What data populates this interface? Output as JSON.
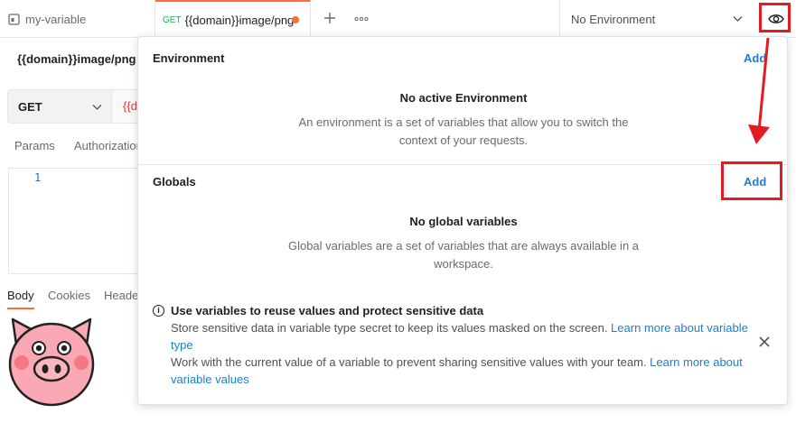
{
  "tabs": {
    "first": {
      "label": "my-variable",
      "icon": "request-icon"
    },
    "active": {
      "method": "GET",
      "label": "{{domain}}image/png",
      "unsaved": true
    },
    "add_icon": "plus-icon",
    "more_icon": "more-icon"
  },
  "environment_selector": {
    "value": "No Environment",
    "icon": "chevron-down-icon"
  },
  "quick_look_icon": "eye-icon",
  "request": {
    "title": "{{domain}}image/png",
    "method": "GET",
    "url_fragment": "{{d",
    "tabs": [
      "Params",
      "Authorization"
    ],
    "editor_line": "1"
  },
  "response": {
    "tabs": [
      "Body",
      "Cookies",
      "Heade"
    ]
  },
  "panel": {
    "environment": {
      "heading": "Environment",
      "add_label": "Add",
      "empty_title": "No active Environment",
      "empty_desc": "An environment is a set of variables that allow you to switch the context of your requests."
    },
    "globals": {
      "heading": "Globals",
      "add_label": "Add",
      "empty_title": "No global variables",
      "empty_desc": "Global variables are a set of variables that are always available in a workspace."
    },
    "info": {
      "icon": "info-icon",
      "title": "Use variables to reuse values and protect sensitive data",
      "line1_text": "Store sensitive data in variable type secret to keep its values masked on the screen. ",
      "line1_link_a": "Learn more about variable",
      "line1_link_b": "type",
      "line2_text": "Work with the current value of a variable to prevent sharing sensitive values with your team. ",
      "line2_link_a": "Learn more about",
      "line2_link_b": "variable values",
      "close_icon": "close-icon"
    }
  },
  "colors": {
    "accent_orange": "#ff6c37",
    "link_blue": "#1f7ed0",
    "annotation_red": "#e31c23",
    "method_green": "#0cbb52"
  }
}
